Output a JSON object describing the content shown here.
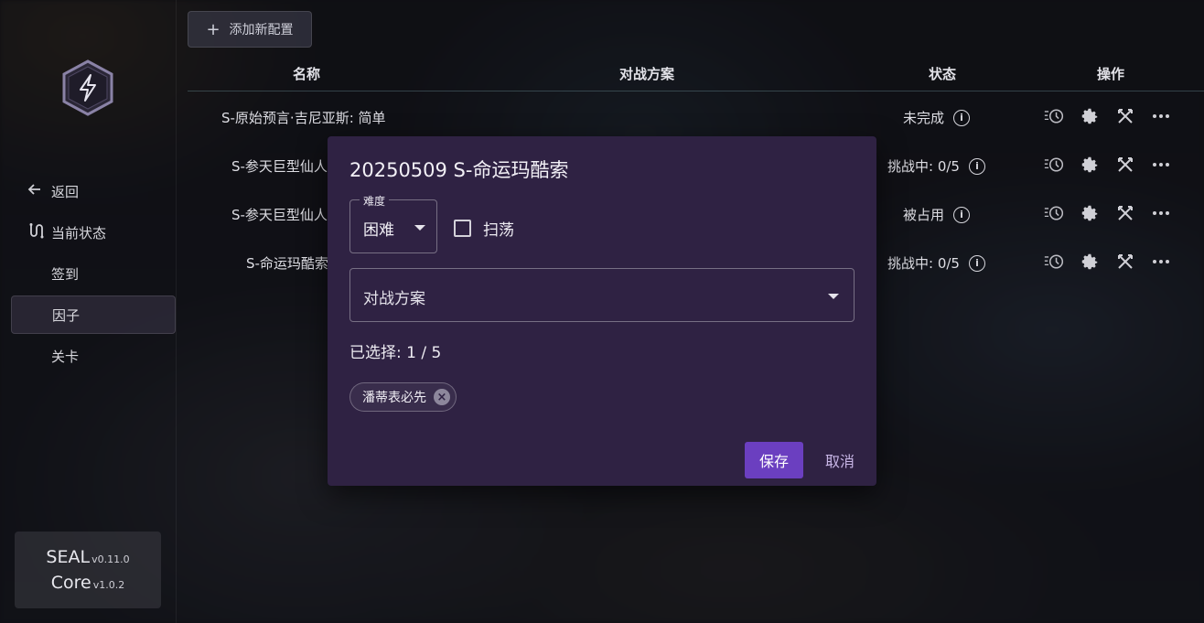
{
  "sidebar": {
    "items": [
      {
        "label": "返回",
        "icon": "arrow-left-icon"
      },
      {
        "label": "当前状态",
        "icon": "route-icon"
      },
      {
        "label": "签到"
      },
      {
        "label": "因子"
      },
      {
        "label": "关卡"
      }
    ],
    "version": {
      "seal_name": "SEAL",
      "seal_version": "v0.11.0",
      "core_name": "Core",
      "core_version": "v1.0.2"
    }
  },
  "toolbar": {
    "add_label": "添加新配置",
    "add_icon": "+"
  },
  "table": {
    "headers": {
      "name": "名称",
      "plan": "对战方案",
      "status": "状态",
      "actions": "操作"
    },
    "rows": [
      {
        "name": "S-原始预言·吉尼亚斯: 简单",
        "status": "未完成"
      },
      {
        "name": "S-参天巨型仙人",
        "status": "挑战中: 0/5"
      },
      {
        "name": "S-参天巨型仙人",
        "status": "被占用"
      },
      {
        "name": "S-命运玛酷索",
        "status": "挑战中: 0/5"
      }
    ]
  },
  "dialog": {
    "title": "20250509 S-命运玛酷索",
    "difficulty_legend": "难度",
    "difficulty_value": "困难",
    "sweep_label": "扫荡",
    "plan_placeholder": "对战方案",
    "selected_count": "已选择: 1 / 5",
    "chip_label": "潘蒂表必先",
    "save_label": "保存",
    "cancel_label": "取消"
  },
  "colors": {
    "accent": "#6b3fc0",
    "dialog_bg": "#2f2243"
  }
}
